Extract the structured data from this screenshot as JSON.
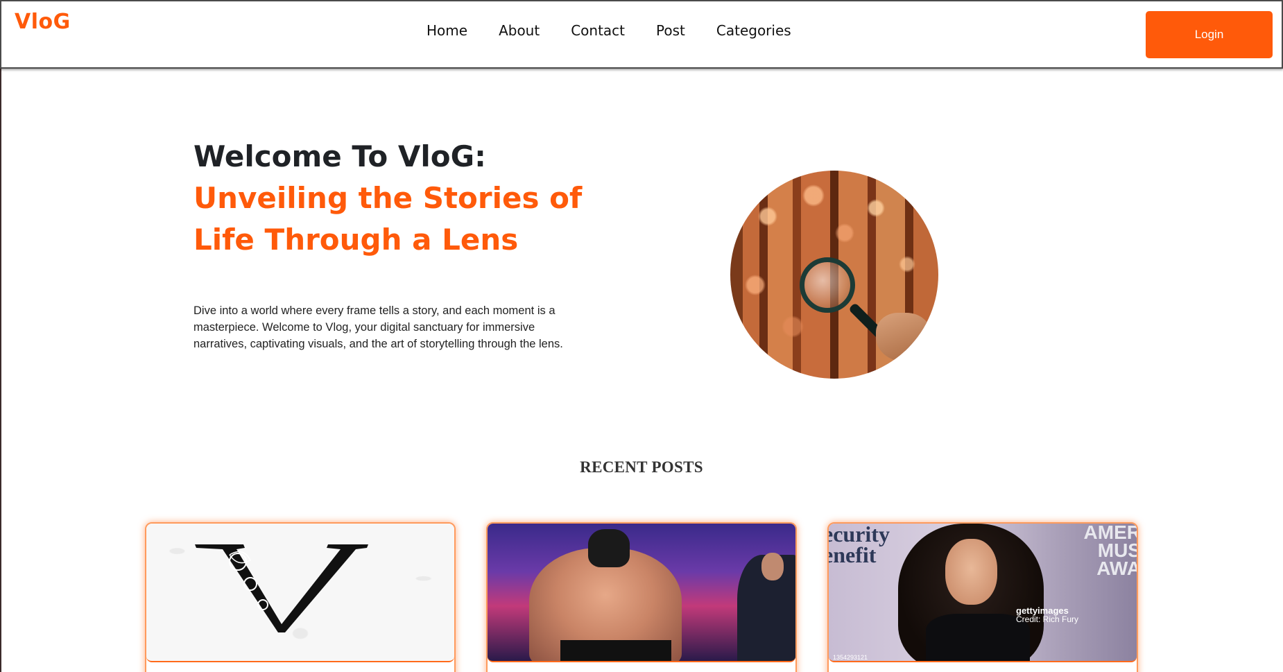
{
  "brand": "VloG",
  "nav": {
    "links": [
      "Home",
      "About",
      "Contact",
      "Post",
      "Categories"
    ],
    "login_label": "Login"
  },
  "hero": {
    "title_line1": "Welcome To VloG:",
    "title_line2": "Unveiling the Stories of Life Through a Lens",
    "description": "Dive into a world where every frame tells a story, and each moment is a masterpiece. Welcome to Vlog, your digital sanctuary for immersive narratives, captivating visuals, and the art of storytelling through the lens.",
    "image_icon": "magnifying-glass-autumn-forest"
  },
  "recent_posts": {
    "heading": "RECENT POSTS",
    "cards": [
      {
        "image": "ornate-letter-v-logo"
      },
      {
        "image": "wrestler-in-ring"
      },
      {
        "image": "celebrity-red-carpet",
        "bg_text": [
          "ecurity",
          "enefit"
        ],
        "ama_text": [
          "AMER",
          "MUS",
          "AWA"
        ],
        "watermark_brand": "gettyimages",
        "watermark_credit": "Credit: Rich Fury",
        "image_id": "1354293121"
      }
    ]
  },
  "colors": {
    "accent": "#ff5a0a",
    "title_dark": "#1f2226",
    "card_glow": "#ff9a5c"
  }
}
